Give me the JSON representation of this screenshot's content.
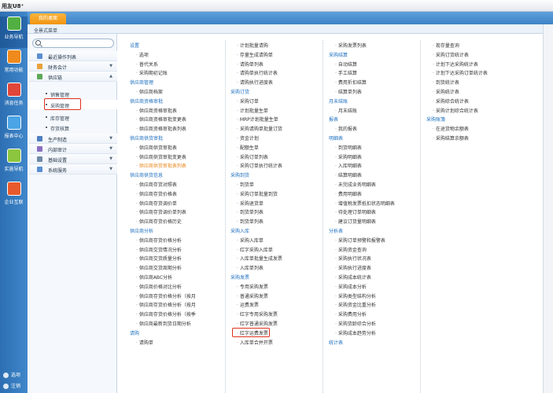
{
  "app": {
    "title": "用友U8⁺"
  },
  "tabs": [
    {
      "label": "我的桌面"
    }
  ],
  "breadcrumb": "全景式菜单",
  "leftbar": [
    {
      "label": "业务导航",
      "color": "#52b043",
      "active": true
    },
    {
      "label": "常用功能",
      "color": "#f08a1c"
    },
    {
      "label": "消息任务",
      "color": "#e0463a"
    },
    {
      "label": "报表中心",
      "color": "#4aa4e6"
    },
    {
      "label": "实施导航",
      "color": "#8cc63e"
    },
    {
      "label": "企业互联",
      "color": "#e85a2d"
    }
  ],
  "leftbar_bottom": [
    "选项",
    "注销"
  ],
  "nav": {
    "search_placeholder": "",
    "items": [
      {
        "label": "最近操作列表",
        "color": "#5b8fd1"
      },
      {
        "label": "财务会计",
        "color": "#e9a23b",
        "arrow": "▼"
      },
      {
        "label": "供应链",
        "color": "#5ea859",
        "arrow": "▲"
      },
      {
        "label": "生产制造",
        "color": "#4f7fbf",
        "arrow": "▼"
      },
      {
        "label": "内部审计",
        "color": "#8a6fc0",
        "arrow": "▼"
      },
      {
        "label": "基础设置",
        "color": "#6f8aa8",
        "arrow": "▼"
      },
      {
        "label": "系统服务",
        "color": "#5b8fd1",
        "arrow": "▼"
      }
    ],
    "sub_items": [
      "销售管理",
      "采购管理",
      "库存管理",
      "存货核算"
    ]
  },
  "menu": {
    "col1": [
      [
        "hd",
        "设置"
      ],
      [
        "lk",
        "选项"
      ],
      [
        "lk",
        "普代关系"
      ],
      [
        "lk",
        "采购期初记账"
      ],
      [
        "hd",
        "供应商管理"
      ],
      [
        "lk",
        "供应商档案"
      ],
      [
        "hd",
        "供应商资格审批"
      ],
      [
        "lk",
        "供应商资格审批表"
      ],
      [
        "lk",
        "供应商资格审批变更表"
      ],
      [
        "lk",
        "供应商资格审批表列表"
      ],
      [
        "hd",
        "供应商供货审批"
      ],
      [
        "lk",
        "供应商供货审批表"
      ],
      [
        "lk",
        "供应商供货审批变更表"
      ],
      [
        "or",
        "供应商供货审批表列表"
      ],
      [
        "hd",
        "供应商供货信息"
      ],
      [
        "lk",
        "供应商存货对照表"
      ],
      [
        "lk",
        "供应商存货价格表"
      ],
      [
        "lk",
        "供应商存货调价单"
      ],
      [
        "lk",
        "供应商存货调价单列表"
      ],
      [
        "lk",
        "供应商存货价格历史"
      ],
      [
        "hd",
        "供应商分析"
      ],
      [
        "lk",
        "供应商存货价格分析"
      ],
      [
        "lk",
        "供应商交货情况分析"
      ],
      [
        "lk",
        "供应商交货质量分析"
      ],
      [
        "lk",
        "供应商交货周期分析"
      ],
      [
        "lk",
        "供应商ABC分析"
      ],
      [
        "lk",
        "供应商价格对比分析"
      ],
      [
        "lk",
        "供应商存货价格分析（按月"
      ],
      [
        "lk",
        "供应商存货价格分析（按月"
      ],
      [
        "lk",
        "供应商存货价格分析（按季"
      ],
      [
        "lk",
        "供应商最新到货日期分析"
      ],
      [
        "hd",
        "请购"
      ],
      [
        "lk",
        "请购单"
      ]
    ],
    "col2": [
      [
        "lk",
        "计划批量请购"
      ],
      [
        "lk",
        "存量生成请购单"
      ],
      [
        "lk",
        "请购单列表"
      ],
      [
        "lk",
        "请购单执行统计表"
      ],
      [
        "lk",
        "请购执行进度表"
      ],
      [
        "hd",
        "采购订货"
      ],
      [
        "lk",
        "采购订单"
      ],
      [
        "lk",
        "计划批量生单"
      ],
      [
        "lk",
        "MRP计划批量生单"
      ],
      [
        "lk",
        "采购请购单批量订货"
      ],
      [
        "lk",
        "资金计划"
      ],
      [
        "lk",
        "配额生单"
      ],
      [
        "lk",
        "采购订单列表"
      ],
      [
        "lk",
        "采购订单执行统计表"
      ],
      [
        "hd",
        "采购到货"
      ],
      [
        "lk",
        "到货单"
      ],
      [
        "lk",
        "采购订单批量到货"
      ],
      [
        "lk",
        "采购退货单"
      ],
      [
        "lk",
        "到货单列表"
      ],
      [
        "lk",
        "到货单列表"
      ],
      [
        "hd",
        "采购入库"
      ],
      [
        "lk",
        "采购入库单"
      ],
      [
        "lk",
        "红字采购入库单"
      ],
      [
        "lk",
        "入库单批量生成发票"
      ],
      [
        "lk",
        "入库单列表"
      ],
      [
        "hd",
        "采购发票"
      ],
      [
        "lk",
        "专用采购发票"
      ],
      [
        "lk",
        "普通采购发票"
      ],
      [
        "lk",
        "运费发票"
      ],
      [
        "lk",
        "红字专用采购发票"
      ],
      [
        "lk",
        "红字普通采购发票"
      ],
      [
        "lk",
        "红字运费发票"
      ],
      [
        "lk",
        "入库单合并开票"
      ]
    ],
    "col3": [
      [
        "lk",
        "采购发票列表"
      ],
      [
        "hd",
        "采购结算"
      ],
      [
        "lk",
        "自动结算"
      ],
      [
        "lk",
        "手工结算"
      ],
      [
        "lk",
        "费用折扣结算"
      ],
      [
        "lk",
        "结算单列表"
      ],
      [
        "hd",
        "月末结账"
      ],
      [
        "lk",
        "月末结账"
      ],
      [
        "hd",
        "报表"
      ],
      [
        "lk",
        "我的报表"
      ],
      [
        "hd",
        "明细表"
      ],
      [
        "lk",
        "到货明细表"
      ],
      [
        "lk",
        "采购明细表"
      ],
      [
        "lk",
        "入库明细表"
      ],
      [
        "lk",
        "结算明细表"
      ],
      [
        "lk",
        "未完成业务明细表"
      ],
      [
        "lk",
        "费用明细表"
      ],
      [
        "lk",
        "增值税发票抵扣状态明细表"
      ],
      [
        "lk",
        "待处理订单明细表"
      ],
      [
        "lk",
        "建议订货量明细表"
      ],
      [
        "hd",
        "分析表"
      ],
      [
        "lk",
        "采购订单预警和报警表"
      ],
      [
        "lk",
        "采购资金查询"
      ],
      [
        "lk",
        "采购执行状况表"
      ],
      [
        "lk",
        "采购执行进度表"
      ],
      [
        "lk",
        "采购成本统计表"
      ],
      [
        "lk",
        "采购成本分析"
      ],
      [
        "lk",
        "采购类型结构分析"
      ],
      [
        "lk",
        "采购资金比重分析"
      ],
      [
        "lk",
        "采购费用分析"
      ],
      [
        "lk",
        "采购货龄综合分析"
      ],
      [
        "lk",
        "采购成本趋势分析"
      ],
      [
        "hd",
        "统计表"
      ]
    ],
    "col4": [
      [
        "lk",
        "现存量查询"
      ],
      [
        "lk",
        "采购订货统计表"
      ],
      [
        "lk",
        "计划下达采购统计表"
      ],
      [
        "lk",
        "计划下达采购订单统计表"
      ],
      [
        "lk",
        "到货统计表"
      ],
      [
        "lk",
        "采购统计表"
      ],
      [
        "lk",
        "采购综合统计表"
      ],
      [
        "lk",
        "采购计划综合统计表"
      ],
      [
        "hd",
        "采购账簿"
      ],
      [
        "lk",
        "在途货物余额表"
      ],
      [
        "lk",
        "采购结算余额表"
      ]
    ]
  }
}
